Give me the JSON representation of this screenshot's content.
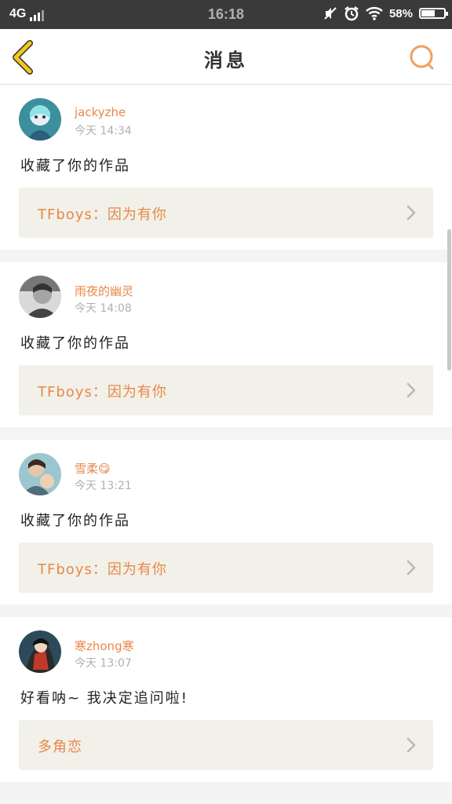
{
  "status_bar": {
    "network": "4G",
    "time": "16:18",
    "battery": "58%"
  },
  "header": {
    "title": "消息"
  },
  "colors": {
    "accent": "#e8874a",
    "back_arrow": "#f2c81d",
    "card_link_bg": "#f2f1e9"
  },
  "messages": [
    {
      "username": "jackyzhe",
      "time": "今天 14:34",
      "text": "收藏了你的作品",
      "work_title": "TFboys：因为有你"
    },
    {
      "username": "雨夜的幽灵",
      "time": "今天 14:08",
      "text": "收藏了你的作品",
      "work_title": "TFboys：因为有你"
    },
    {
      "username": "雪柔😋",
      "time": "今天 13:21",
      "text": "收藏了你的作品",
      "work_title": "TFboys：因为有你"
    },
    {
      "username": "寒zhong寒",
      "time": "今天 13:07",
      "text": "好看呐~ 我决定追问啦!",
      "work_title": "多角恋"
    }
  ]
}
